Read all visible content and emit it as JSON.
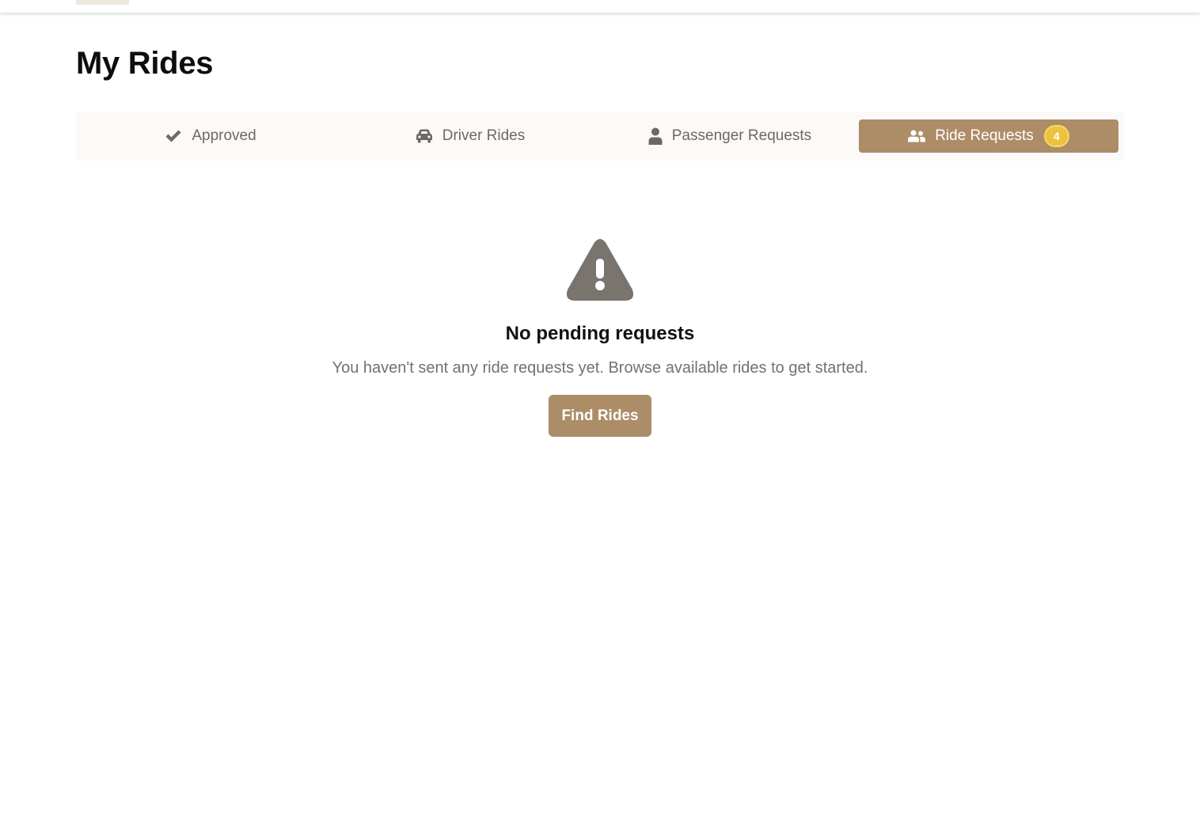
{
  "header": {
    "logo_icon": "logo-icon"
  },
  "page": {
    "title": "My Rides"
  },
  "tabs": [
    {
      "label": "Approved",
      "icon": "check-icon",
      "active": false
    },
    {
      "label": "Driver Rides",
      "icon": "car-icon",
      "active": false
    },
    {
      "label": "Passenger Requests",
      "icon": "user-icon",
      "active": false
    },
    {
      "label": "Ride Requests",
      "icon": "users-icon",
      "active": true,
      "badge": "4"
    }
  ],
  "empty_state": {
    "icon": "warning-icon",
    "title": "No pending requests",
    "message": "You haven't sent any ride requests yet. Browse available rides to get started.",
    "button_label": "Find Rides"
  },
  "colors": {
    "accent": "#ad8c68",
    "badge": "#efc140",
    "muted_text": "#77706a",
    "icon_gray": "#7a746e"
  }
}
